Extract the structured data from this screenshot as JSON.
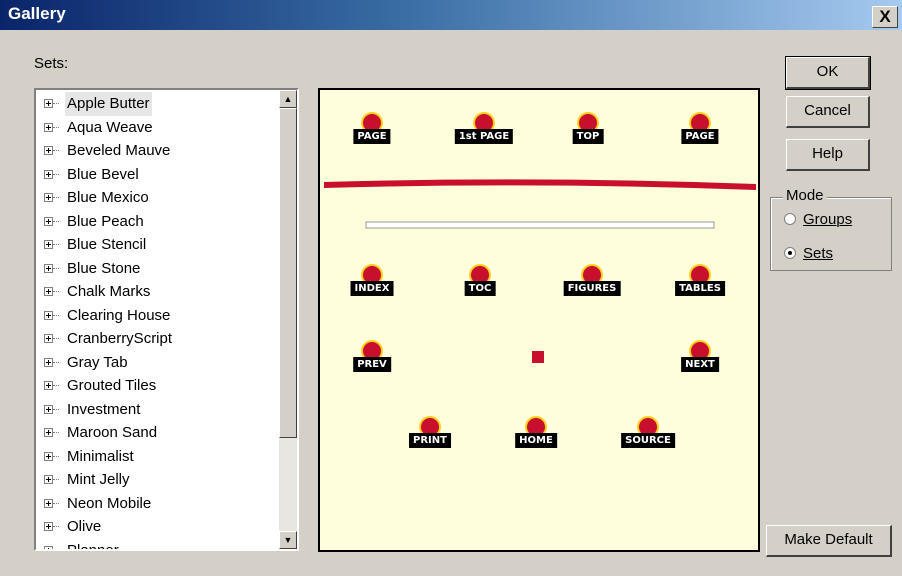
{
  "window": {
    "title": "Gallery",
    "close_glyph": "X"
  },
  "sets_label": "Sets:",
  "sets": [
    "Apple Butter",
    "Aqua Weave",
    "Beveled Mauve",
    "Blue Bevel",
    "Blue Mexico",
    "Blue Peach",
    "Blue Stencil",
    "Blue Stone",
    "Chalk Marks",
    "Clearing House",
    "CranberryScript",
    "Gray Tab",
    "Grouted Tiles",
    "Investment",
    "Maroon Sand",
    "Minimalist",
    "Mint Jelly",
    "Neon Mobile",
    "Olive",
    "Planner"
  ],
  "selected_set": "Apple Butter",
  "buttons": {
    "ok": "OK",
    "cancel": "Cancel",
    "help": "Help",
    "make_default": "Make Default"
  },
  "mode": {
    "legend": "Mode",
    "options": [
      {
        "label": "Groups",
        "checked": false
      },
      {
        "label": "Sets",
        "checked": true
      }
    ]
  },
  "preview": {
    "labels": {
      "prev_page": "PAGE",
      "first_page": "1st PAGE",
      "top": "TOP",
      "next_page": "PAGE",
      "index": "INDEX",
      "toc": "TOC",
      "figures": "FIGURES",
      "tables": "TABLES",
      "prev": "PREV",
      "next": "NEXT",
      "print": "PRINT",
      "home": "HOME",
      "source": "SOURCE"
    },
    "colors": {
      "background": "#fffedc",
      "accent": "#c8102e",
      "ring": "#ffd020"
    }
  }
}
